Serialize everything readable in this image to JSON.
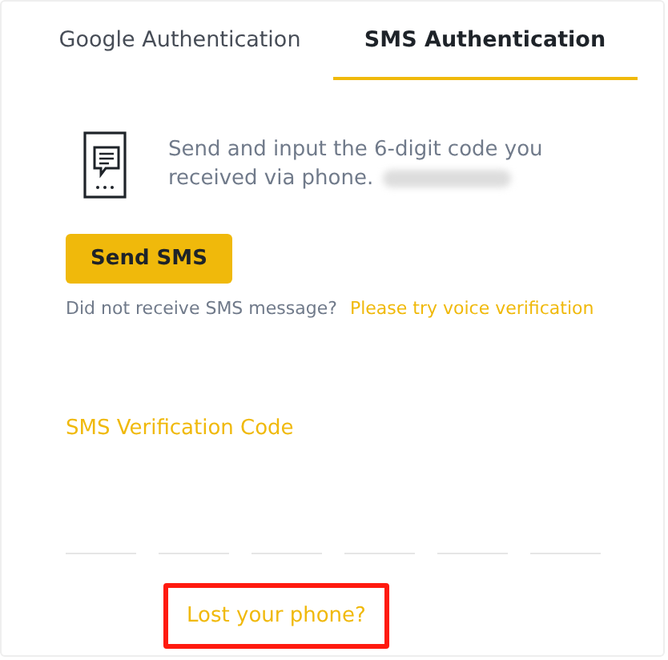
{
  "tabs": [
    {
      "label": "Google Authentication",
      "selected": false
    },
    {
      "label": "SMS Authentication",
      "selected": true
    }
  ],
  "instruction": {
    "text": "Send and input the 6-digit code you received via phone.",
    "phone_redacted": true
  },
  "send_button": "Send SMS",
  "voice_hint": {
    "text": "Did not receive SMS message?",
    "link": "Please try voice verification"
  },
  "code_label": "SMS Verification Code",
  "digits": [
    {
      "filled": false
    },
    {
      "filled": false
    },
    {
      "filled": false
    },
    {
      "filled": false
    },
    {
      "filled": false
    },
    {
      "filled": false
    }
  ],
  "lost_phone": {
    "label": "Lost your phone?",
    "highlighted": true
  }
}
